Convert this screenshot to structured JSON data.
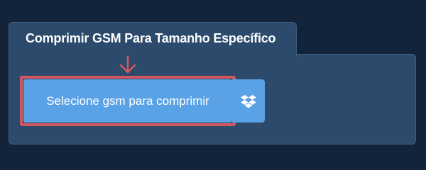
{
  "tab": {
    "title": "Comprimir GSM Para Tamanho Específico"
  },
  "upload": {
    "button_label": "Selecione gsm para comprimir"
  },
  "icons": {
    "pointer": "arrow-down-icon",
    "cloud": "dropbox-icon"
  },
  "colors": {
    "page_background": "#12233a",
    "panel": "#2c4a6b",
    "button": "#5aa2e6",
    "highlight": "#d4565e"
  }
}
